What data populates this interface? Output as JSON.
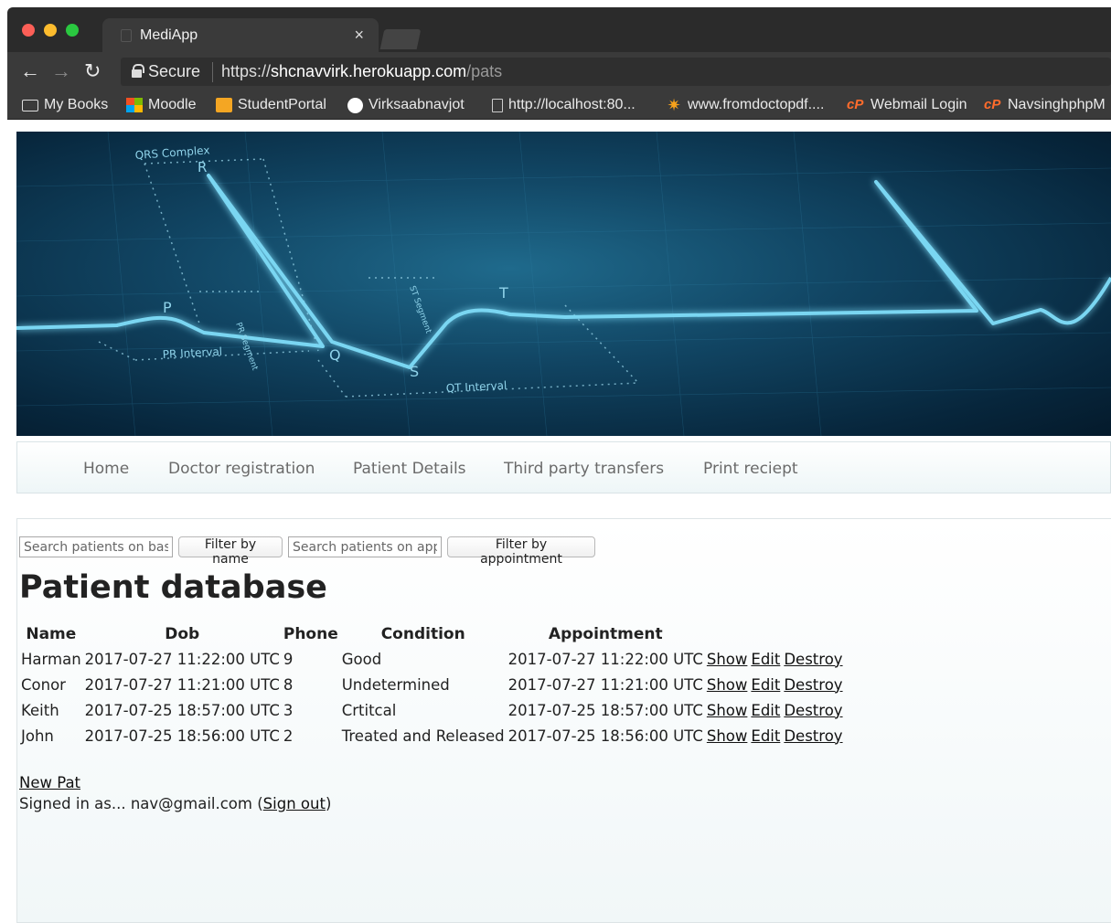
{
  "browser": {
    "tab_title": "MediApp",
    "tab_close": "×",
    "secure_label": "Secure",
    "url_scheme": "https://",
    "url_host": "shcnavvirk.herokuapp.com",
    "url_path": "/pats",
    "bookmarks": [
      {
        "label": "My Books",
        "icon": "folder-icon"
      },
      {
        "label": "Moodle",
        "icon": "microsoft-icon"
      },
      {
        "label": "StudentPortal",
        "icon": "studentportal-icon"
      },
      {
        "label": "Virksaabnavjot",
        "icon": "github-icon"
      },
      {
        "label": "http://localhost:80...",
        "icon": "page-icon"
      },
      {
        "label": "www.fromdoctopdf....",
        "icon": "star-icon"
      },
      {
        "label": "Webmail Login",
        "icon": "cpanel-icon"
      },
      {
        "label": "NavsinghphpM",
        "icon": "cpanel-icon"
      }
    ]
  },
  "banner": {
    "labels": [
      "QRS Complex",
      "R",
      "P",
      "Q",
      "S",
      "T",
      "PR Interval",
      "QT Interval",
      "PR Segment",
      "ST Segment"
    ]
  },
  "nav": {
    "items": [
      "Home",
      "Doctor registration",
      "Patient Details",
      "Third party transfers",
      "Print reciept"
    ]
  },
  "search": {
    "name_placeholder": "Search patients on basis of name",
    "name_button": "Filter by name",
    "appt_placeholder": "Search patients on appointment",
    "appt_button": "Filter by appointment"
  },
  "page_title": "Patient database",
  "table": {
    "headers": [
      "Name",
      "Dob",
      "Phone",
      "Condition",
      "Appointment"
    ],
    "rows": [
      {
        "name": "Harman",
        "dob": "2017-07-27 11:22:00 UTC",
        "phone": "9",
        "condition": "Good",
        "appointment": "2017-07-27 11:22:00 UTC"
      },
      {
        "name": "Conor",
        "dob": "2017-07-27 11:21:00 UTC",
        "phone": "8",
        "condition": "Undetermined",
        "appointment": "2017-07-27 11:21:00 UTC"
      },
      {
        "name": "Keith",
        "dob": "2017-07-25 18:57:00 UTC",
        "phone": "3",
        "condition": "Crtitcal",
        "appointment": "2017-07-25 18:57:00 UTC"
      },
      {
        "name": "John",
        "dob": "2017-07-25 18:56:00 UTC",
        "phone": "2",
        "condition": "Treated and Released",
        "appointment": "2017-07-25 18:56:00 UTC"
      }
    ],
    "show_label": "Show",
    "edit_label": "Edit",
    "destroy_label": "Destroy"
  },
  "new_pat_label": "New Pat",
  "signed_in": {
    "prefix": "Signed in as... nav@gmail.com (",
    "sign_out": "Sign out",
    "suffix": ")"
  }
}
